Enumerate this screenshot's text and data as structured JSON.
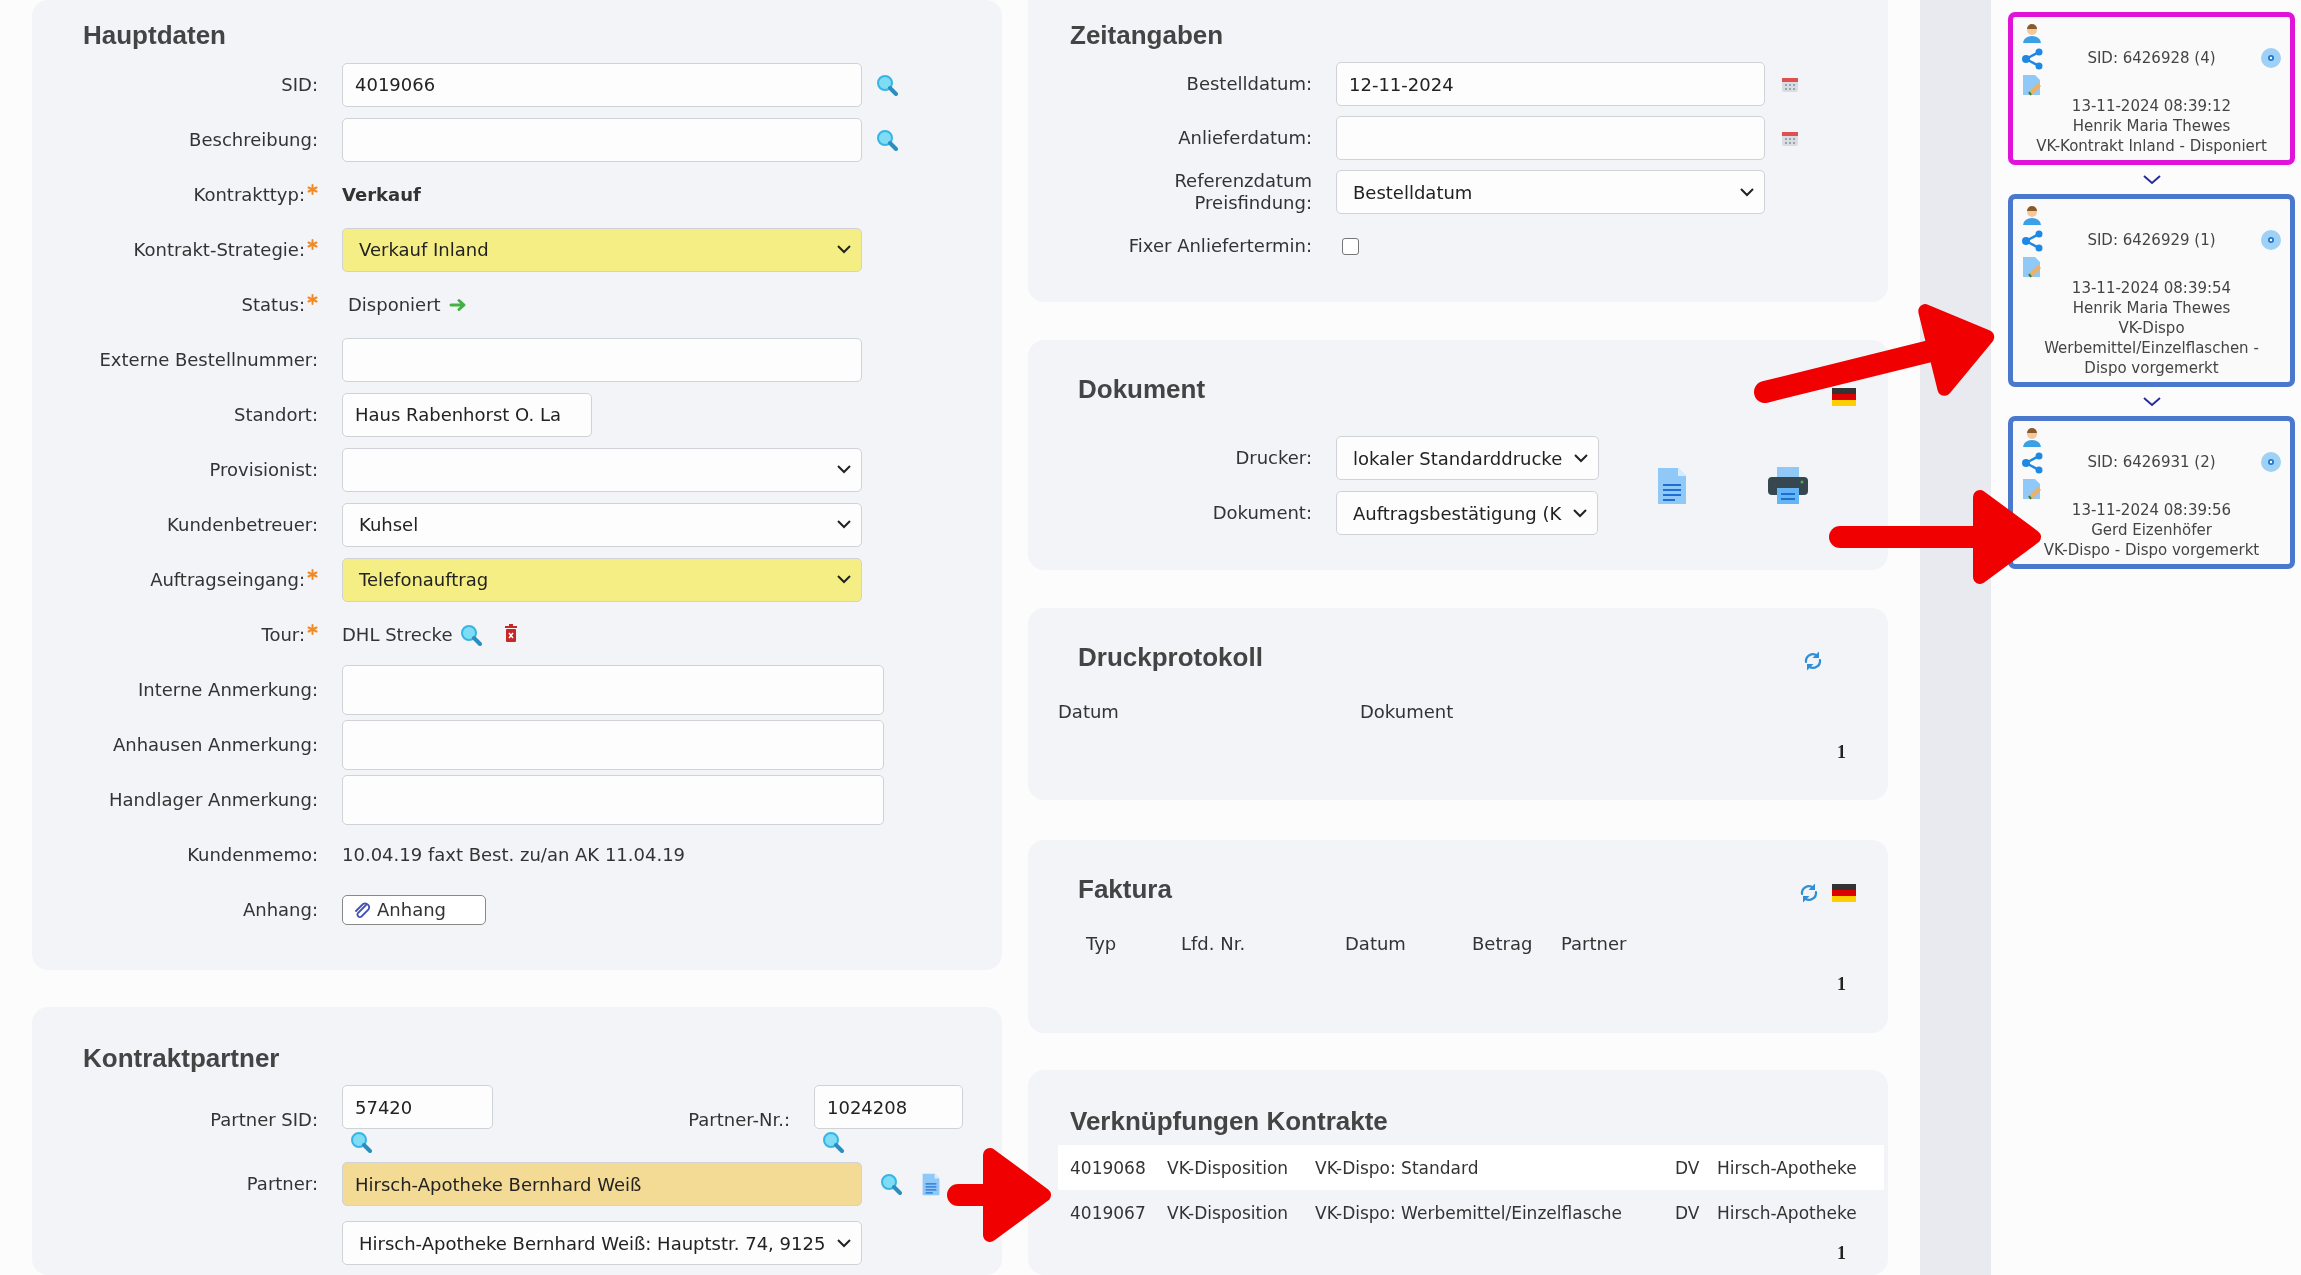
{
  "hauptdaten": {
    "title": "Hauptdaten",
    "rows": [
      {
        "kind": "input",
        "label": "SID:",
        "required": false,
        "value": "4019066",
        "search": true
      },
      {
        "kind": "input",
        "label": "Beschreibung:",
        "required": false,
        "search": true
      },
      {
        "kind": "bold_text",
        "label": "Kontrakttyp:",
        "required": true,
        "value": "Verkauf"
      },
      {
        "kind": "select",
        "label": "Kontrakt-Strategie:",
        "required": true,
        "value": "Verkauf Inland",
        "highlighted": true
      },
      {
        "kind": "status",
        "label": "Status:",
        "required": true,
        "value": "Disponiert"
      },
      {
        "kind": "input",
        "label": "Externe Bestellnummer:",
        "required": false,
        "search": false
      },
      {
        "kind": "short_input",
        "label": "Standort:",
        "required": false,
        "value": "Haus Rabenhorst O. La"
      },
      {
        "kind": "select",
        "label": "Provisionist:",
        "required": false,
        "highlighted": false
      },
      {
        "kind": "select",
        "label": "Kundenbetreuer:",
        "required": false,
        "value": "Kuhsel",
        "highlighted": false
      },
      {
        "kind": "select",
        "label": "Auftragseingang:",
        "required": true,
        "value": "Telefonauftrag",
        "highlighted": true
      },
      {
        "kind": "tour",
        "label": "Tour:",
        "required": true,
        "value": "DHL Strecke"
      },
      {
        "kind": "note",
        "label": "Interne Anmerkung:",
        "required": false
      },
      {
        "kind": "note",
        "label": "Anhausen Anmerkung:",
        "required": false
      },
      {
        "kind": "note",
        "label": "Handlager Anmerkung:",
        "required": false
      },
      {
        "kind": "text",
        "label": "Kundenmemo:",
        "required": false,
        "value": "10.04.19 faxt Best. zu/an AK 11.04.19"
      },
      {
        "kind": "attachment",
        "label": "Anhang:",
        "required": false,
        "value": "Anhang"
      }
    ]
  },
  "kontraktpartner": {
    "title": "Kontraktpartner",
    "partner_sid": {
      "label": "Partner SID:",
      "value": "57420"
    },
    "partner_nr": {
      "label": "Partner-Nr.:",
      "value": "1024208"
    },
    "partner": {
      "label": "Partner:",
      "value": "Hirsch-Apotheke Bernhard Weiß"
    },
    "address": {
      "value": "Hirsch-Apotheke Bernhard Weiß: Hauptstr. 74, 9125"
    }
  },
  "zeitangaben": {
    "title": "Zeitangaben",
    "rows": [
      {
        "kind": "date",
        "label": "Bestelldatum:",
        "value": "12-11-2024"
      },
      {
        "kind": "date",
        "label": "Anlieferdatum:"
      },
      {
        "kind": "select",
        "label": "Referenzdatum Preisfindung:",
        "value": "Bestelldatum"
      },
      {
        "kind": "checkbox",
        "label": "Fixer Anliefertermin:",
        "checked": false
      }
    ]
  },
  "dokument": {
    "title": "Dokument",
    "printer": {
      "label": "Drucker:",
      "value": "lokaler Standarddrucke"
    },
    "document": {
      "label": "Dokument:",
      "value": "Auftragsbestätigung (K"
    }
  },
  "druckprotokoll": {
    "title": "Druckprotokoll",
    "columns": [
      "Datum",
      "Dokument"
    ],
    "page": "1"
  },
  "faktura": {
    "title": "Faktura",
    "columns": [
      "Typ",
      "Lfd. Nr.",
      "Datum",
      "Betrag",
      "Partner"
    ],
    "page": "1"
  },
  "verknuepfungen": {
    "title": "Verknüpfungen Kontrakte",
    "rows": [
      {
        "cells": [
          "4019068",
          "VK-Disposition",
          "VK-Dispo: Standard",
          "DV",
          "Hirsch-Apotheke"
        ],
        "highlighted": true
      },
      {
        "cells": [
          "4019067",
          "VK-Disposition",
          "VK-Dispo: Werbemittel/Einzelflasche",
          "DV",
          "Hirsch-Apotheke"
        ],
        "highlighted": false
      }
    ],
    "page": "1"
  },
  "history": [
    {
      "sid": "SID: 6426928 (4)",
      "timestamp": "13-11-2024 08:39:12",
      "user": "Henrik Maria Thewes",
      "status": "VK-Kontrakt Inland - Disponiert",
      "selected": true
    },
    {
      "sid": "SID: 6426929 (1)",
      "timestamp": "13-11-2024 08:39:54",
      "user": "Henrik Maria Thewes",
      "status": "VK-Dispo Werbemittel/Einzelflaschen - Dispo vorgemerkt",
      "selected": false
    },
    {
      "sid": "SID: 6426931 (2)",
      "timestamp": "13-11-2024 08:39:56",
      "user": "Gerd Eizenhöfer",
      "status": "VK-Dispo - Dispo vorgemerkt",
      "selected": false
    }
  ]
}
